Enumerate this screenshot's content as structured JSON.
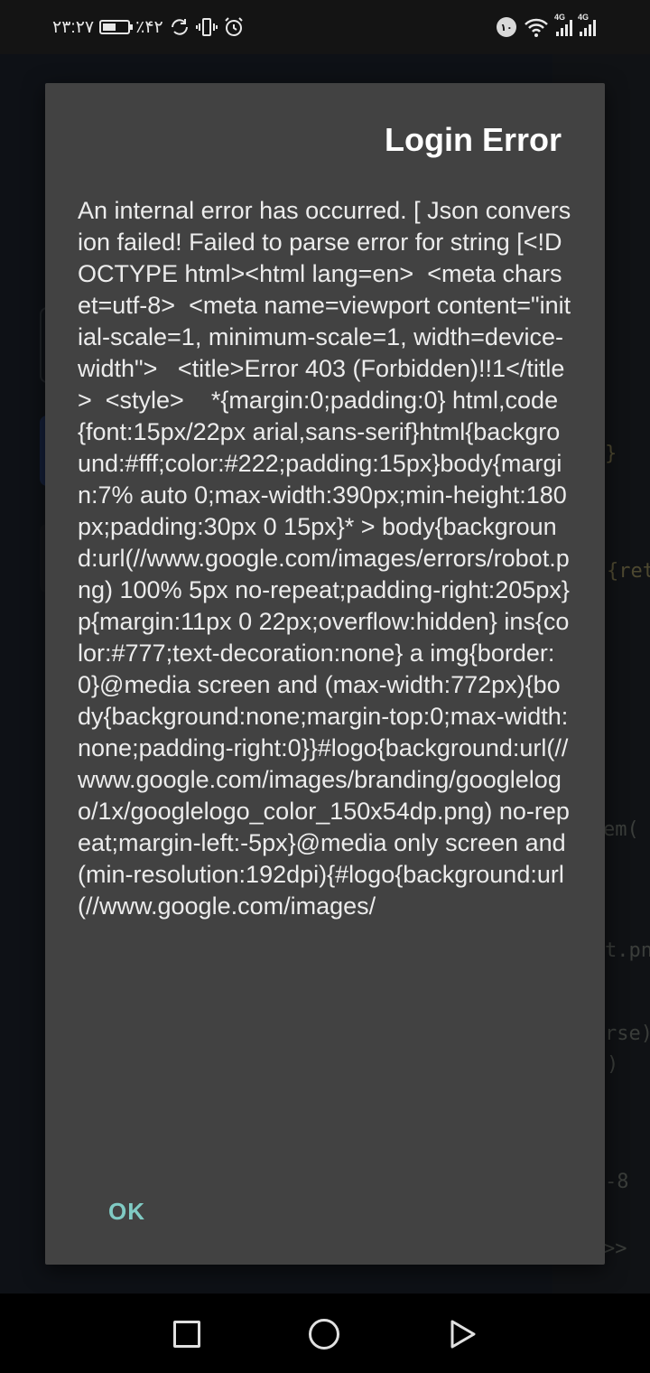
{
  "status_bar": {
    "time": "۲۳:۲۷",
    "battery": "٪۴۲",
    "notification_count": "۱۰",
    "network_1": "4G",
    "network_2": "4G"
  },
  "background": {
    "code_fragments": [
      "}",
      "{ret",
      "em(",
      "t.pn",
      "rse)",
      ")",
      "-8",
      ">>"
    ]
  },
  "dialog": {
    "title": "Login Error",
    "message": "An internal error has occurred. [ Json conversion failed! Failed to parse error for string [<!DOCTYPE html><html lang=en>  <meta charset=utf-8>  <meta name=viewport content=\"initial-scale=1, minimum-scale=1, width=device-width\">   <title>Error 403 (Forbidden)!!1</title>  <style>    *{margin:0;padding:0} html,code{font:15px/22px arial,sans-serif}html{background:#fff;color:#222;padding:15px}body{margin:7% auto 0;max-width:390px;min-height:180px;padding:30px 0 15px}* > body{background:url(//www.google.com/images/errors/robot.png) 100% 5px no-repeat;padding-right:205px} p{margin:11px 0 22px;overflow:hidden} ins{color:#777;text-decoration:none} a img{border:0}@media screen and (max-width:772px){body{background:none;margin-top:0;max-width:none;padding-right:0}}#logo{background:url(//www.google.com/images/branding/googlelogo/1x/googlelogo_color_150x54dp.png) no-repeat;margin-left:-5px}@media only screen and (min-resolution:192dpi){#logo{background:url(//www.google.com/images/",
    "ok_label": "OK"
  },
  "colors": {
    "dialog_bg": "#424242",
    "accent": "#80cbc4",
    "text": "#ececec"
  }
}
